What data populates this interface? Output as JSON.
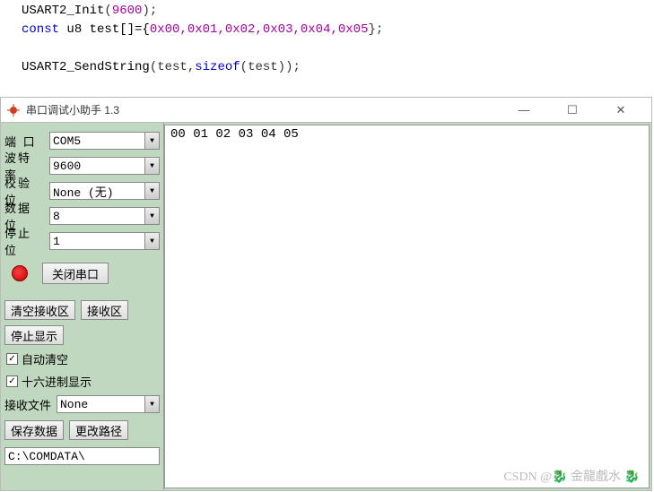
{
  "code": {
    "line1_fn": "USART2_Init",
    "line1_arg": "9600",
    "line2_a": "const",
    "line2_b": " u8 test[]={",
    "line2_vals": "0x00,0x01,0x02,0x03,0x04,0x05",
    "line2_c": "};",
    "line3_fn": "USART2_SendString",
    "line3_a": "(test,",
    "line3_b": "sizeof",
    "line3_c": "(test));"
  },
  "window": {
    "title": "串口调试小助手 1.3"
  },
  "side": {
    "port_label": "端  口",
    "port_value": "COM5",
    "baud_label": "波特率",
    "baud_value": "9600",
    "parity_label": "校验位",
    "parity_value": "None (无)",
    "data_label": "数据位",
    "data_value": "8",
    "stop_label": "停止位",
    "stop_value": "1",
    "close_btn": "关闭串口",
    "clear_rx_btn": "清空接收区",
    "rx_area_btn": "接收区",
    "stop_disp_btn": "停止显示",
    "auto_clear": "自动清空",
    "hex_disp": "十六进制显示",
    "rx_file_label": "接收文件",
    "rx_file_value": "None",
    "save_btn": "保存数据",
    "change_path_btn": "更改路径",
    "path": "C:\\COMDATA\\"
  },
  "rx": {
    "content": "00 01 02 03 04 05"
  },
  "watermark": "CSDN @🐉 金龍戲水 🐉"
}
